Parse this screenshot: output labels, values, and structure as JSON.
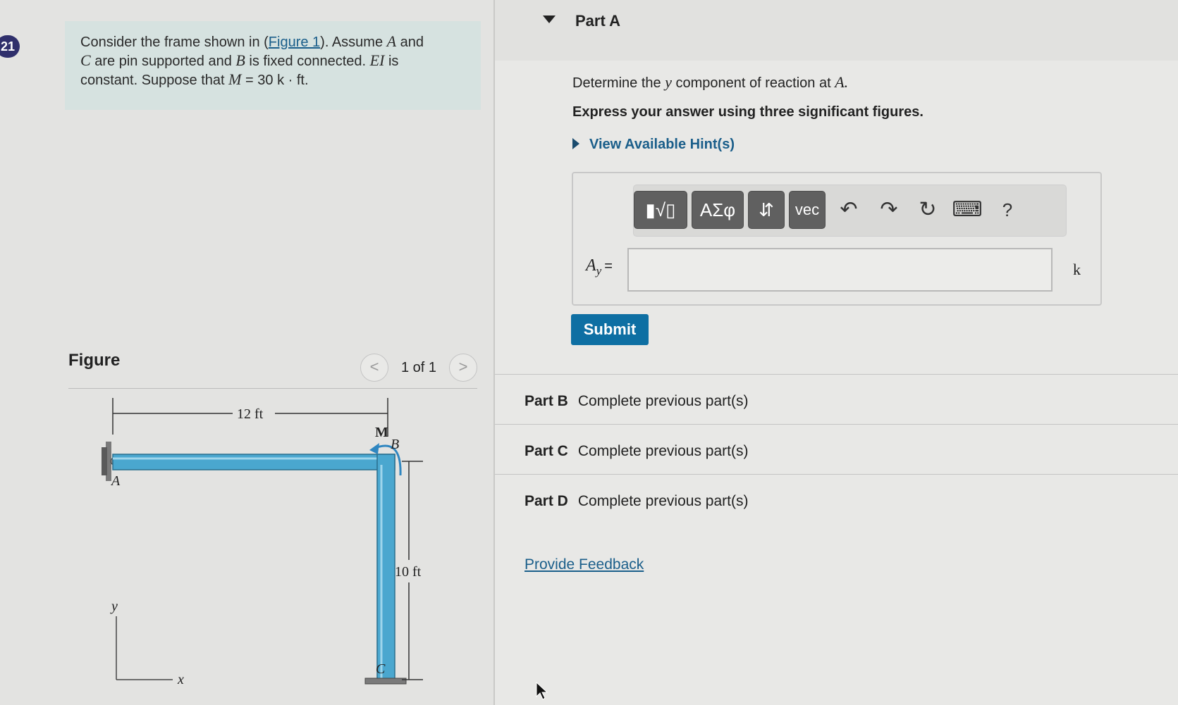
{
  "question_number": "21",
  "problem": {
    "line1_pre": "Consider the frame shown in (",
    "figure_link": "Figure 1",
    "line1_post": "). Assume",
    "var_a": "A",
    "and": "and",
    "var_c": "C",
    "line2": "are pin supported and",
    "var_b": "B",
    "line2b": "is fixed connected.",
    "var_ei": "EI",
    "is": "is",
    "line3": "constant. Suppose that",
    "moment_expr": "M",
    "moment_value": "= 30 k · ft."
  },
  "figure": {
    "title": "Figure",
    "prev_label": "<",
    "next_label": ">",
    "count": "1 of 1",
    "dim_horizontal": "12 ft",
    "dim_vertical": "10 ft",
    "label_m": "M",
    "label_a": "A",
    "label_b": "B",
    "label_c": "C",
    "axis_x": "x",
    "axis_y": "y"
  },
  "part_a": {
    "title": "Part A",
    "question_pre": "Determine the",
    "question_var": "y",
    "question_mid": "component of reaction at",
    "question_at": "A.",
    "instruction": "Express your answer using three significant figures.",
    "hints_label": "View Available Hint(s)",
    "toolbar": {
      "templates": "▮√▯",
      "greek": "ΑΣφ",
      "arrows": "⇵",
      "vec": "vec",
      "undo": "↶",
      "redo": "↷",
      "reset": "↻",
      "keyboard": "⌨",
      "help": "?"
    },
    "answer_label_main": "A",
    "answer_label_sub": "y",
    "answer_eq": "=",
    "answer_value": "",
    "unit": "k",
    "submit_label": "Submit"
  },
  "other_parts": [
    {
      "label": "Part B",
      "status": "Complete previous part(s)"
    },
    {
      "label": "Part C",
      "status": "Complete previous part(s)"
    },
    {
      "label": "Part D",
      "status": "Complete previous part(s)"
    }
  ],
  "feedback_label": "Provide Feedback",
  "colors": {
    "link": "#1a5e8a",
    "submit": "#0e6fa3",
    "frame_member": "#4aa7cf",
    "badge": "#2f2f6b"
  }
}
